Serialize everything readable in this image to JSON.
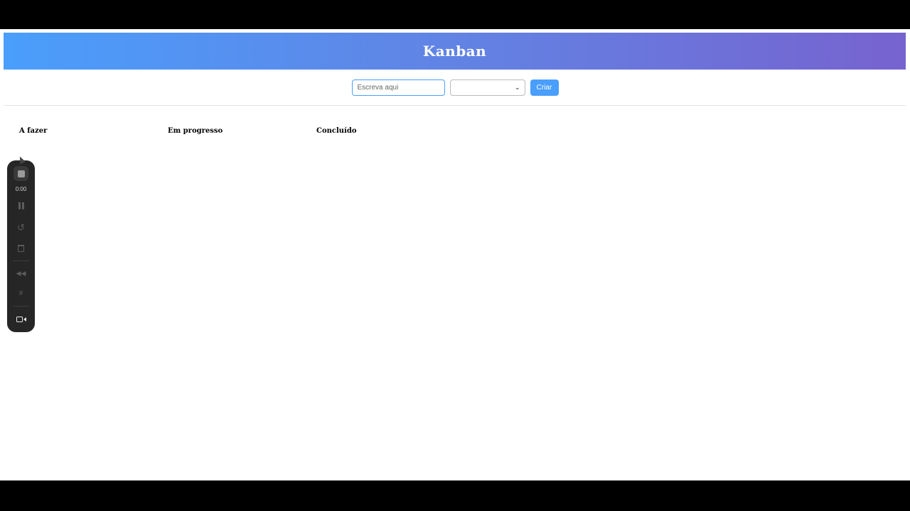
{
  "header": {
    "title": "Kanban"
  },
  "form": {
    "task_input": {
      "value": "",
      "placeholder": "Escreva aqui"
    },
    "status_select": {
      "selected": ""
    },
    "create_label": "Criar"
  },
  "columns": [
    {
      "title": "A fazer"
    },
    {
      "title": "Em progresso"
    },
    {
      "title": "Concluído"
    }
  ],
  "recorder": {
    "time": "0:00",
    "icons": [
      "stop-icon",
      "pause-icon",
      "restart-icon",
      "trash-icon",
      "rewind-icon",
      "grid-icon",
      "camera-icon"
    ]
  },
  "colors": {
    "banner_start": "#4a9efc",
    "banner_end": "#7763cf",
    "accent": "#4a9efc"
  }
}
